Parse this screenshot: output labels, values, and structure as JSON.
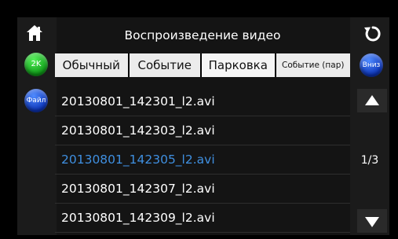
{
  "header": {
    "title": "Воспроизведение видео",
    "home_icon": "home-icon",
    "back_icon": "back-refresh-icon"
  },
  "left": {
    "resolution_badge": "2K",
    "file_badge": "Файл"
  },
  "right": {
    "down_badge": "Вниз",
    "page_indicator": "1/3"
  },
  "tabs": [
    {
      "label": "Обычный"
    },
    {
      "label": "Событие"
    },
    {
      "label": "Парковка"
    },
    {
      "label": "Событие (пар)"
    }
  ],
  "files": [
    {
      "name": "20130801_142301_l2.avi",
      "selected": false
    },
    {
      "name": "20130801_142303_l2.avi",
      "selected": false
    },
    {
      "name": "20130801_142305_l2.avi",
      "selected": true
    },
    {
      "name": "20130801_142307_l2.avi",
      "selected": false
    },
    {
      "name": "20130801_142309_l2.avi",
      "selected": false
    }
  ],
  "colors": {
    "selected_text": "#3f8fe0",
    "badge_green": "#0d9a16",
    "badge_blue": "#0b33b8"
  }
}
